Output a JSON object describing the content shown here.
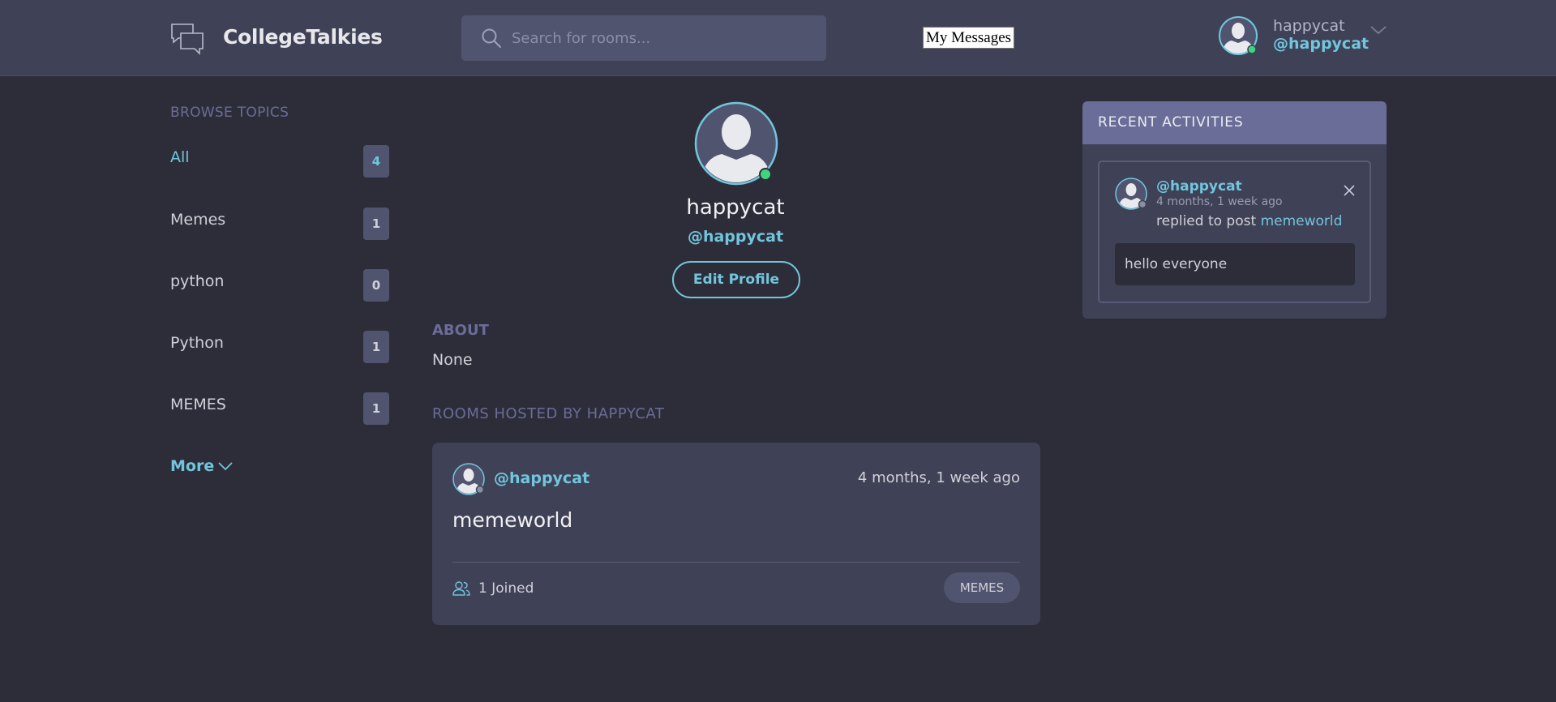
{
  "app": {
    "name": "CollegeTalkies"
  },
  "header": {
    "search_placeholder": "Search for rooms...",
    "messages_label": "My Messages",
    "user": {
      "name": "happycat",
      "handle": "@happycat"
    }
  },
  "sidebar": {
    "title": "BROWSE TOPICS",
    "topics": [
      {
        "label": "All",
        "count": "4",
        "active": true
      },
      {
        "label": "Memes",
        "count": "1"
      },
      {
        "label": "python",
        "count": "0"
      },
      {
        "label": "Python",
        "count": "1"
      },
      {
        "label": "MEMES",
        "count": "1"
      }
    ],
    "more_label": "More"
  },
  "profile": {
    "name": "happycat",
    "handle": "@happycat",
    "edit_label": "Edit Profile",
    "about_title": "ABOUT",
    "about_text": "None",
    "rooms_title": "ROOMS HOSTED BY HAPPYCAT",
    "rooms": [
      {
        "host": "@happycat",
        "time": "4 months, 1 week ago",
        "name": "memeworld",
        "joined": "1 Joined",
        "tag": "MEMES"
      }
    ]
  },
  "activity": {
    "title": "RECENT ACTIVITIES",
    "items": [
      {
        "handle": "@happycat",
        "time": "4 months, 1 week ago",
        "action": "replied to post",
        "target": "memeworld",
        "body": "hello everyone"
      }
    ]
  },
  "colors": {
    "background": "#2d2d39",
    "header": "#3f4156",
    "accent": "#71c6dd",
    "muted": "#696d97",
    "online": "#3ed67c"
  }
}
